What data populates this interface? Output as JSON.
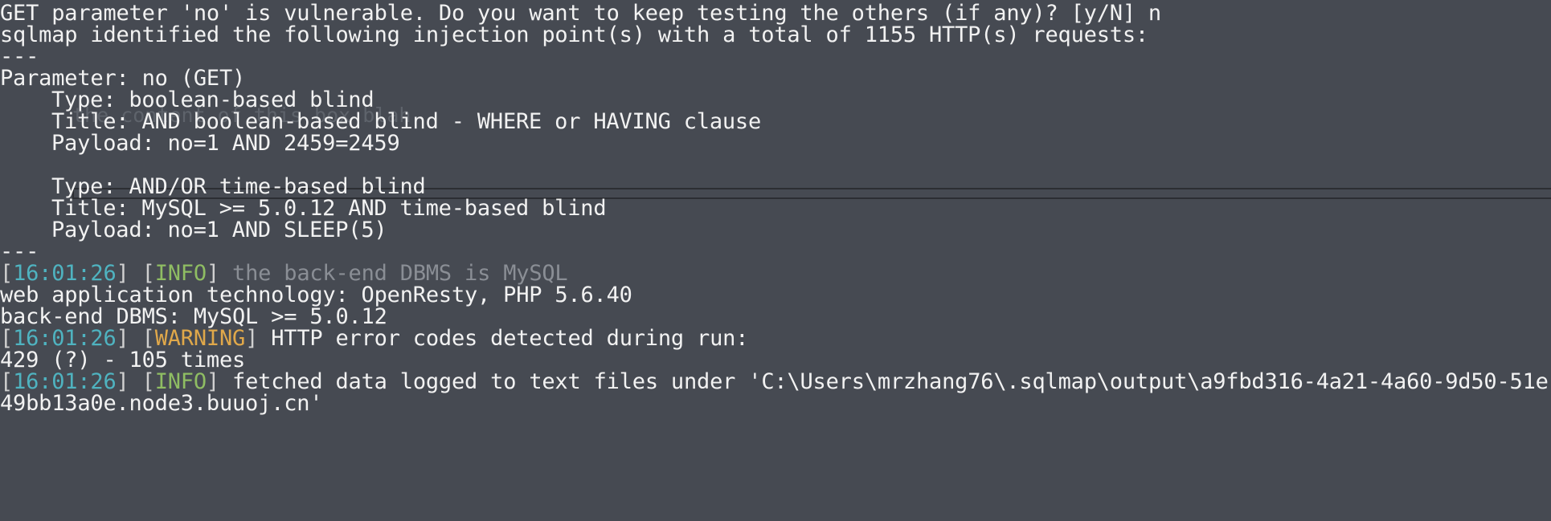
{
  "terminal": {
    "lines": {
      "l1": "GET parameter 'no' is vulnerable. Do you want to keep testing the others (if any)? [y/N] n",
      "l2": "sqlmap identified the following injection point(s) with a total of 1155 HTTP(s) requests:",
      "l3": "---",
      "l4": "Parameter: no (GET)",
      "l5": "Type: boolean-based blind",
      "l6": "Title: AND boolean-based blind - WHERE or HAVING clause",
      "l7": "Payload: no=1 AND 2459=2459",
      "l8": "Type: AND/OR time-based blind",
      "l9": "Title: MySQL >= 5.0.12 AND time-based blind",
      "l10": "Payload: no=1 AND SLEEP(5)",
      "l11": "---",
      "l13": "web application technology: OpenResty, PHP 5.6.40",
      "l14": "back-end DBMS: MySQL >= 5.0.12",
      "l16": "429 (?) - 105 times",
      "l18": "49bb13a0e.node3.buuoj.cn'"
    },
    "log1": {
      "time": "16:01:26",
      "level": "INFO",
      "message": "the back-end DBMS is MySQL"
    },
    "log2": {
      "time": "16:01:26",
      "level": "WARNING",
      "message": "HTTP error codes detected during run:"
    },
    "log3": {
      "time": "16:01:26",
      "level": "INFO",
      "message": "fetched data logged to text files under 'C:\\Users\\mrzhang76\\.sqlmap\\output\\a9fbd316-4a21-4a60-9d50-51e"
    },
    "ghost_overlay": "the content of this box blah"
  },
  "colors": {
    "background": "#464a52",
    "text": "#f2f2f2",
    "timestamp": "#4fb3c0",
    "info": "#8fbd63",
    "warning": "#e0a84a"
  }
}
